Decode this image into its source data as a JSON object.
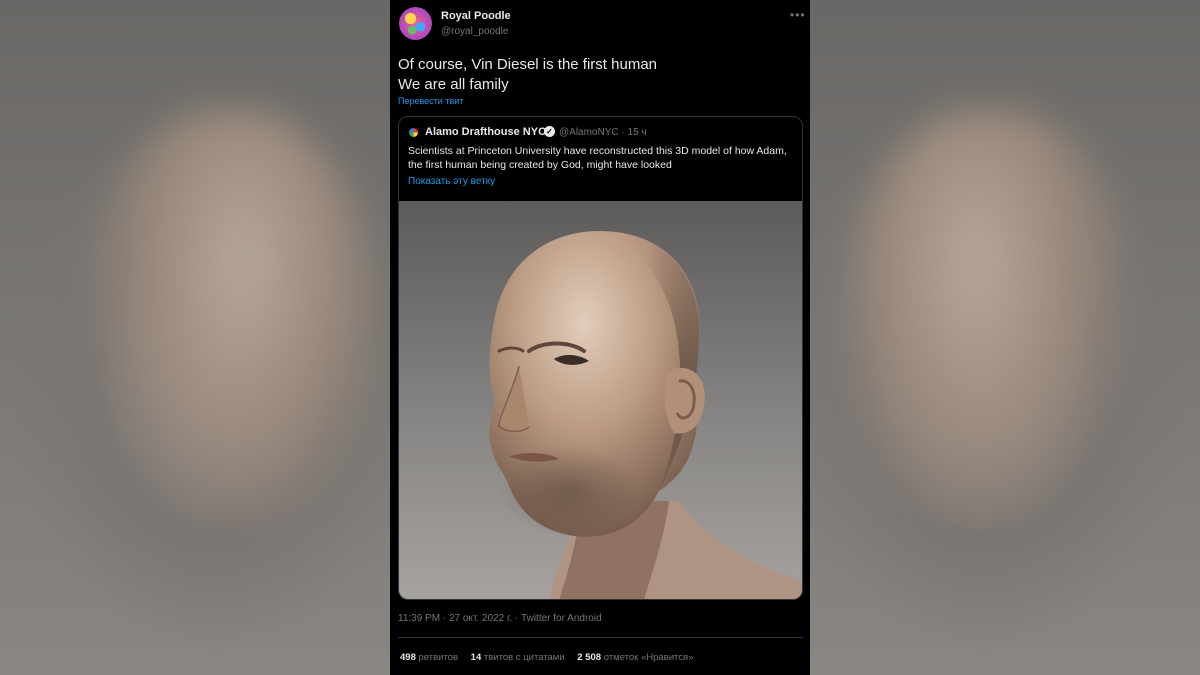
{
  "tweet": {
    "author_name": "Royal Poodle",
    "author_handle": "@royal_poodle",
    "text_line1": "Of course, Vin Diesel is the first human",
    "text_line2": "We are all family",
    "translate_label": "Перевести твит",
    "more_icon": "more-horizontal-icon"
  },
  "quote": {
    "author_name": "Alamo Drafthouse NYC",
    "author_handle": "@AlamoNYC",
    "separator": "·",
    "time_ago": "15 ч",
    "verified_icon": "verified-badge-icon",
    "text": "Scientists at Princeton University have reconstructed this 3D model of how Adam, the first human being created by God, might have looked",
    "show_thread_label": "Показать эту ветку"
  },
  "meta": {
    "timestamp": "11:39 PM · 27 окт. 2022 г. · Twitter for Android"
  },
  "stats": {
    "retweets_count": "498",
    "retweets_label": "ретвитов",
    "quotes_count": "14",
    "quotes_label": "твитов с цитатами",
    "likes_count": "2 508",
    "likes_label": "отметок «Нравится»"
  },
  "colors": {
    "background": "#000000",
    "text": "#e7e9ea",
    "muted": "#71767b",
    "link": "#1d9bf0",
    "border": "#2f3336"
  }
}
